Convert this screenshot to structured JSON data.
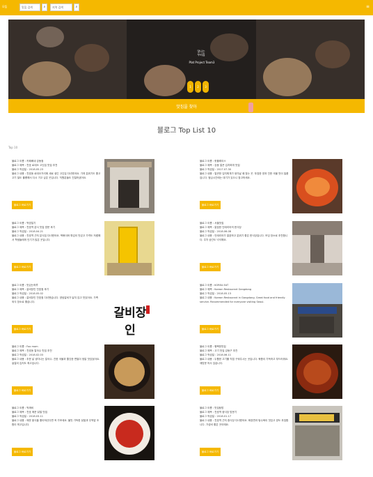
{
  "topbar": {
    "brand": "모둠",
    "search1_placeholder": "맛집 검색",
    "search2_placeholder": "지역 검색",
    "search_button": "검색",
    "menu_icon": "menu-icon"
  },
  "hero": {
    "logo_text": "맛나는 우리집",
    "tagline": "Plat Project Team3",
    "dots": [
      "1",
      "2",
      "3"
    ]
  },
  "banner": {
    "text": "맛집을 찾아"
  },
  "section": {
    "title": "블로그 Top List 10",
    "label": "Top 10"
  },
  "cards": [
    {
      "name": "블로그 이름 : 카페베네 강동점",
      "title": "블로그 제목 : 천호 로데오 고깃집 맛집 추천",
      "date": "블로그 작성일 : 2018.05.23",
      "desc": "블로그 내용 : 천호동 로데오거리에 새로 생긴 고깃집 다녀왔어요. 가게 분위기도 좋고 고기 질도 훌륭해서 다시 가고 싶은 곳입니다. 직원분들도 친절하셨어요.",
      "button": "블로그 바로가기"
    },
    {
      "name": "블로그 이름 : 핫플레이스",
      "title": "블로그 제목 : 강동 얼큰 김치찌개 맛집",
      "date": "블로그 작성일 : 2017.07.30",
      "desc": "블로그 내용 : 얼큰한 김치찌개가 생각날 때 찾는 곳. 푸짐한 양과 진한 국물 맛이 일품입니다. 점심시간에는 대기가 있으니 참고하세요.",
      "button": "블로그 바로가기"
    },
    {
      "name": "블로그 이름 : 먹방일기",
      "title": "블로그 제목 : 천호역 분식 맛집 방문 후기",
      "date": "블로그 작성일 : 2018.04.21",
      "desc": "블로그 내용 : 천호역 근처 분식집 다녀왔어요. 떡볶이와 튀김이 맛있고 가격도 저렴해서 학생들에게 인기가 많은 곳입니다.",
      "button": "블로그 바로가기"
    },
    {
      "name": "블로그 이름 : 서울맛집",
      "title": "블로그 제목 : 깔끔한 인테리어의 한식당",
      "date": "블로그 작성일 : 2018.06.08",
      "desc": "블로그 내용 : 인테리어가 깔끔하고 분위기 좋은 한식당입니다. 모임 장소로 추천합니다. 주차 공간도 넉넉해요.",
      "button": "블로그 바로가기"
    },
    {
      "name": "블로그 이름 : 맛있는하루",
      "title": "블로그 제목 : 갈비장인 천호점 후기",
      "date": "블로그 작성일 : 2018.05.02",
      "desc": "블로그 내용 : 갈비장인 천호점 다녀왔습니다. 양념갈비가 달지 않고 맛있어요. 가족 외식 장소로 좋습니다.",
      "button": "블로그 바로가기"
    },
    {
      "name": "블로그 이름 : KOREA EAT",
      "title": "블로그 제목 : Korean Restaurant Gangdong",
      "date": "블로그 작성일 : 2018.05.13",
      "desc": "블로그 내용 : Korean Restaurant in Gangdong. Great food and friendly service. Recommended for everyone visiting Seoul.",
      "button": "블로그 바로가기"
    },
    {
      "name": "블로그 이름 : Fox mom",
      "title": "블로그 제목 : 천호동 칼국수 맛집 추천",
      "date": "블로그 작성일 : 2018.02.03",
      "desc": "블로그 내용 : 추운 날 생각나는 칼국수. 진한 국물과 쫄깃한 면발이 정말 맛있었어요. 겉절이 김치도 최고입니다.",
      "button": "블로그 바로가기"
    },
    {
      "name": "블로그 이름 : 행복한맛집",
      "title": "블로그 제목 : 고기 맛집 강동구 추천",
      "date": "블로그 작성일 : 2018.06.11",
      "desc": "블로그 내용 : 두툼한 고기를 직접 구워주시는 곳입니다. 육즙이 가득하고 부드러워요. 재방문 의사 있습니다.",
      "button": "블로그 바로가기"
    },
    {
      "name": "블로그 이름 : 먹깨비",
      "title": "블로그 제목 : 천호 매운 닭발 맛집",
      "date": "블로그 작성일 : 2018.03.11",
      "desc": "블로그 내용 : 매운 음식을 좋아하신다면 꼭 가보세요. 불맛 가득한 닭발과 주먹밥 조합이 최고입니다.",
      "button": "블로그 바로가기"
    },
    {
      "name": "블로그 이름 : 맛집탐방",
      "title": "블로그 제목 : 천호역 중식당 방문기",
      "date": "블로그 작성일 : 2018.01.17",
      "desc": "블로그 내용 : 천호역 근처 중식당 다녀왔어요. 짜장면과 탕수육이 맛있고 양도 푸짐합니다. 가성비 좋은 곳이에요.",
      "button": "블로그 바로가기"
    }
  ],
  "thumb_overlay": "갈비장인"
}
